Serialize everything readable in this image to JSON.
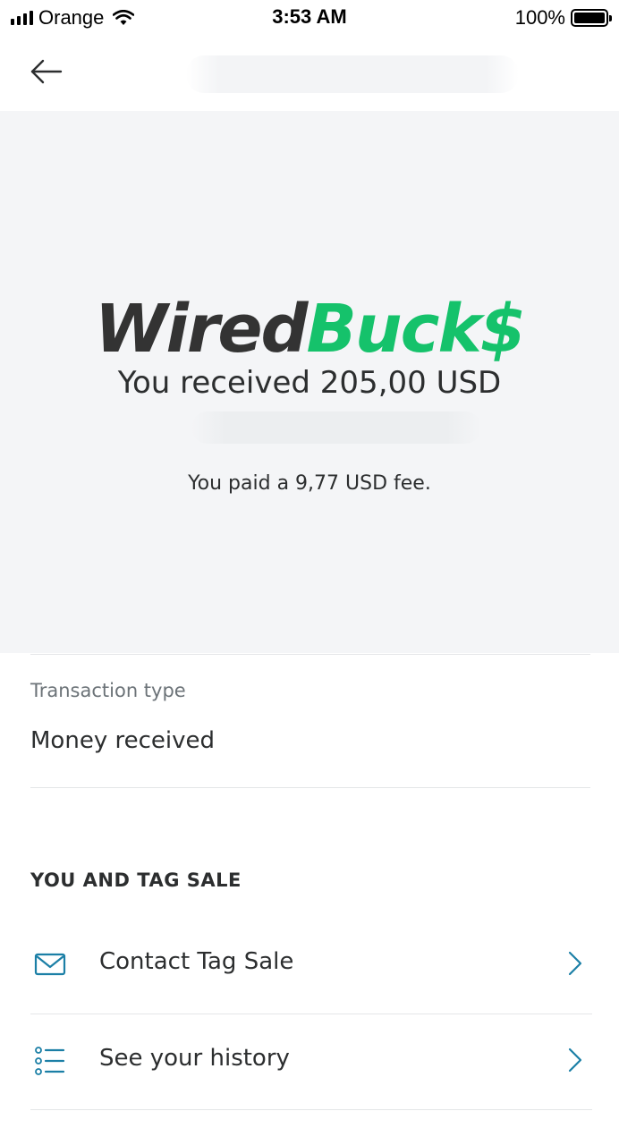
{
  "status_bar": {
    "carrier": "Orange",
    "time": "3:53 AM",
    "battery_percent": "100%",
    "battery_level": 1.0,
    "signal_bars": 4
  },
  "nav": {
    "back_icon": "arrow-left-icon"
  },
  "hero": {
    "brand_part1": "Wired",
    "brand_part2": "Buck$",
    "brand_color_dark": "#333333",
    "brand_color_accent": "#15c26b",
    "received_text": "You received 205,00 USD",
    "fee_text": "You paid a 9,77 USD fee."
  },
  "transaction": {
    "type_label": "Transaction type",
    "type_value": "Money received"
  },
  "counterparty": {
    "section_title": "YOU AND TAG SALE",
    "actions": [
      {
        "label": "Contact Tag Sale",
        "icon": "envelope-icon"
      },
      {
        "label": "See your history",
        "icon": "list-icon"
      }
    ]
  },
  "colors": {
    "hero_background": "#f4f5f7",
    "icon_accent": "#1b7fa6",
    "text_primary": "#2c2e2f",
    "text_secondary": "#6c7378"
  }
}
